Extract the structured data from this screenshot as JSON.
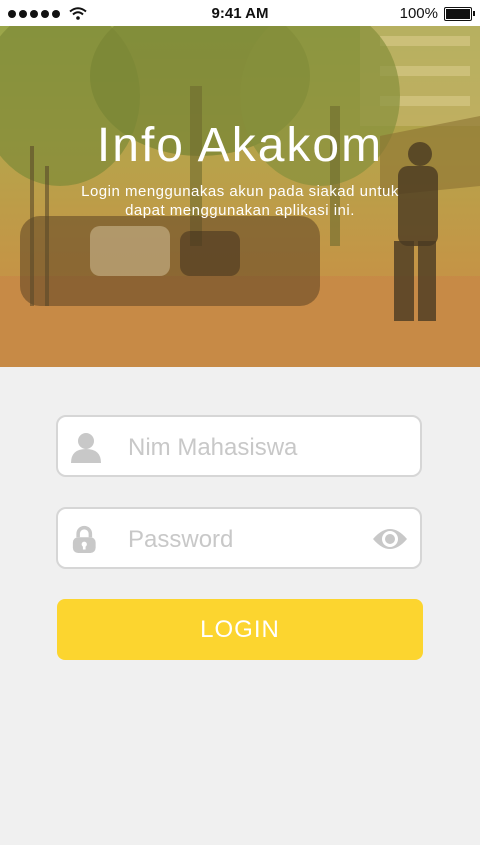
{
  "status_bar": {
    "time": "9:41 AM",
    "battery": "100%"
  },
  "hero": {
    "title": "Info Akakom",
    "subtitle": "Login menggunakas akun pada siakad untuk dapat menggunakan aplikasi ini."
  },
  "form": {
    "nim_placeholder": "Nim Mahasiswa",
    "password_placeholder": "Password",
    "login_label": "LOGIN"
  },
  "colors": {
    "accent": "#fcd52f",
    "background": "#f0f0f0",
    "icon": "#c8c8c8"
  },
  "icons": {
    "nim": "user-icon",
    "password": "lock-icon",
    "reveal": "eye-icon"
  }
}
